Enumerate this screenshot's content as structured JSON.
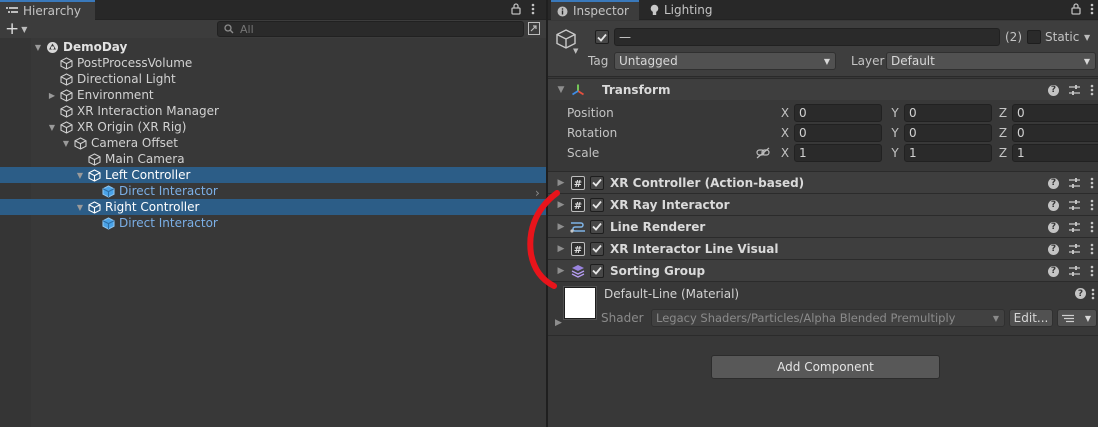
{
  "hierarchy": {
    "tab_label": "Hierarchy",
    "add_label": "+",
    "search_placeholder": "All",
    "items": [
      {
        "label": "DemoDay",
        "type": "scene"
      },
      {
        "label": "PostProcessVolume"
      },
      {
        "label": "Directional Light"
      },
      {
        "label": "Environment"
      },
      {
        "label": "XR Interaction Manager"
      },
      {
        "label": "XR Origin (XR Rig)"
      },
      {
        "label": "Camera Offset"
      },
      {
        "label": "Main Camera"
      },
      {
        "label": "Left Controller",
        "selected": true
      },
      {
        "label": "Direct Interactor",
        "type": "prefab"
      },
      {
        "label": "Right Controller",
        "selected": true
      },
      {
        "label": "Direct Interactor",
        "type": "prefab"
      }
    ]
  },
  "inspector": {
    "tab_label": "Inspector",
    "lighting_tab_label": "Lighting",
    "name_value": "—",
    "multi_count": "(2)",
    "static_label": "Static",
    "tag_label": "Tag",
    "tag_value": "Untagged",
    "layer_label": "Layer",
    "layer_value": "Default",
    "transform": {
      "title": "Transform",
      "rows": [
        {
          "label": "Position",
          "x": "0",
          "y": "0",
          "z": "0"
        },
        {
          "label": "Rotation",
          "x": "0",
          "y": "0",
          "z": "0"
        },
        {
          "label": "Scale",
          "x": "1",
          "y": "1",
          "z": "1"
        }
      ],
      "axis_x": "X",
      "axis_y": "Y",
      "axis_z": "Z"
    },
    "components": [
      {
        "title": "XR Controller (Action-based)",
        "icon": "script-icon"
      },
      {
        "title": "XR Ray Interactor",
        "icon": "script-icon"
      },
      {
        "title": "Line Renderer",
        "icon": "line-renderer-icon"
      },
      {
        "title": "XR Interactor Line Visual",
        "icon": "script-icon"
      },
      {
        "title": "Sorting Group",
        "icon": "sorting-group-icon"
      }
    ],
    "material": {
      "title": "Default-Line (Material)",
      "shader_label": "Shader",
      "shader_value": "Legacy Shaders/Particles/Alpha Blended Premultiply",
      "edit_label": "Edit..."
    },
    "add_component_label": "Add Component"
  },
  "colors": {
    "selection": "#2c5d87",
    "accent_tab": "#3a79bb",
    "prefab_text": "#7bafe6",
    "annotation": "#e8141b"
  }
}
